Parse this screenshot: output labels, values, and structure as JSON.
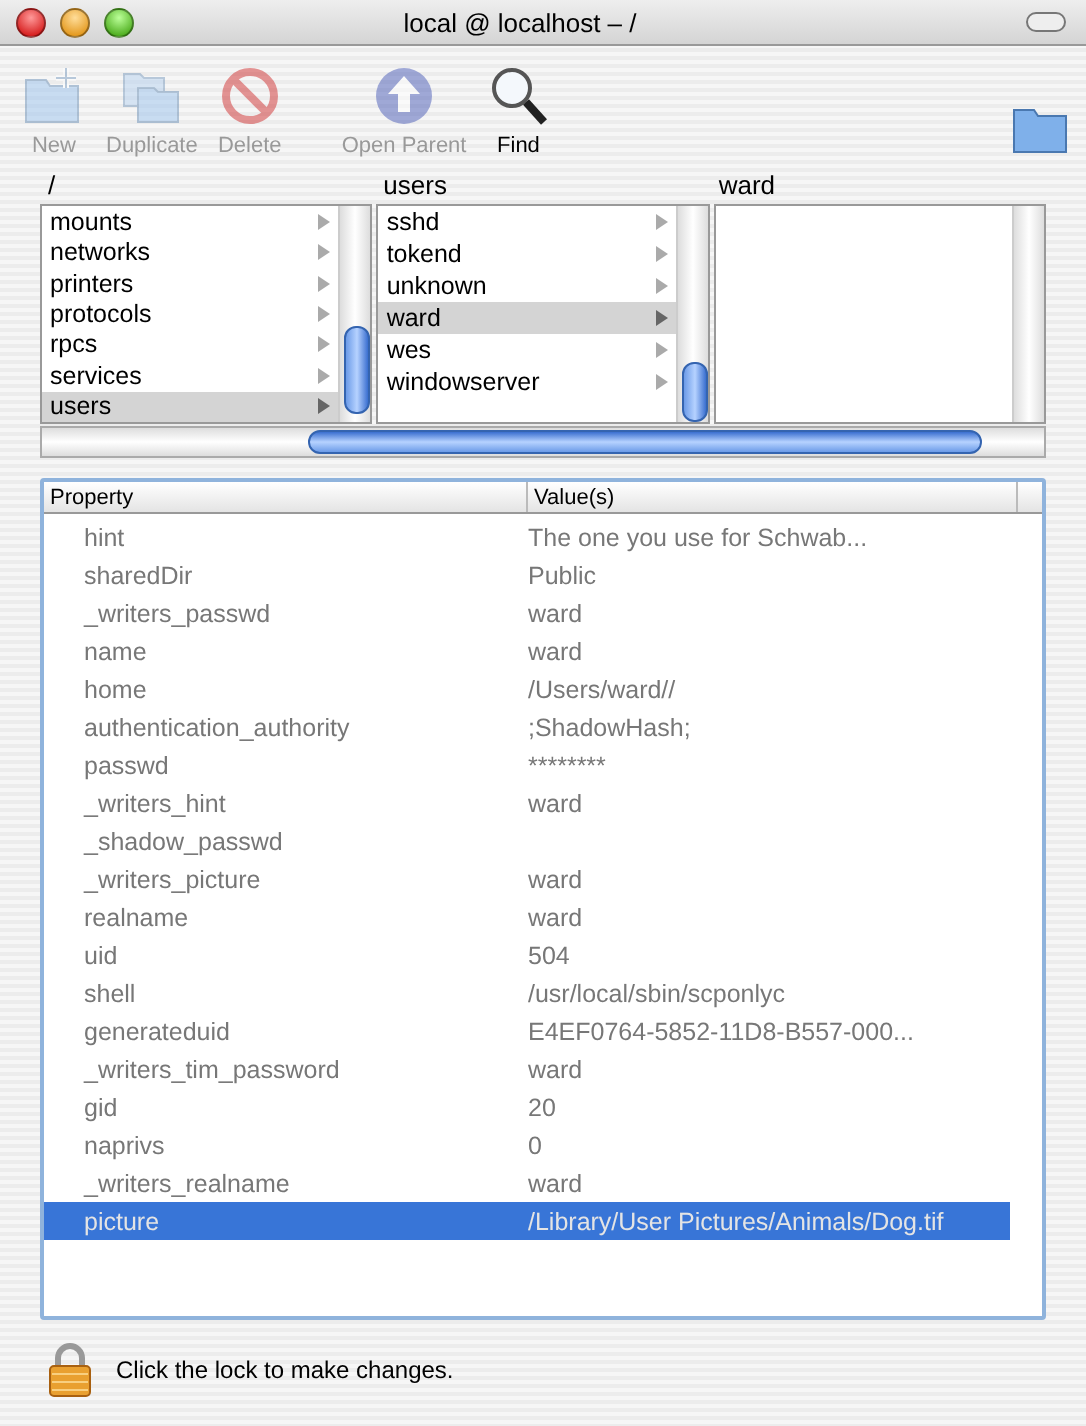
{
  "window": {
    "title": "local @ localhost – /"
  },
  "toolbar": [
    {
      "label": "New",
      "kind": "new",
      "disabled": true
    },
    {
      "label": "Duplicate",
      "kind": "duplicate",
      "disabled": true
    },
    {
      "label": "Delete",
      "kind": "delete",
      "disabled": true
    },
    {
      "label": "Open Parent",
      "kind": "parent",
      "disabled": true
    },
    {
      "label": "Find",
      "kind": "find",
      "disabled": false
    }
  ],
  "browser": {
    "columns": [
      {
        "heading": "/",
        "items": [
          {
            "label": "mounts",
            "selected": false
          },
          {
            "label": "networks",
            "selected": false
          },
          {
            "label": "printers",
            "selected": false
          },
          {
            "label": "protocols",
            "selected": false
          },
          {
            "label": "rpcs",
            "selected": false
          },
          {
            "label": "services",
            "selected": false
          },
          {
            "label": "users",
            "selected": true
          }
        ]
      },
      {
        "heading": "users",
        "items": [
          {
            "label": "sshd",
            "selected": false
          },
          {
            "label": "tokend",
            "selected": false
          },
          {
            "label": "unknown",
            "selected": false
          },
          {
            "label": "ward",
            "selected": true
          },
          {
            "label": "wes",
            "selected": false
          },
          {
            "label": "windowserver",
            "selected": false
          }
        ]
      },
      {
        "heading": "ward"
      }
    ]
  },
  "table": {
    "columns": [
      "Property",
      "Value(s)"
    ],
    "rows": [
      {
        "property": "hint",
        "value": "The one you use for Schwab...",
        "selected": false
      },
      {
        "property": "sharedDir",
        "value": "Public",
        "selected": false
      },
      {
        "property": "_writers_passwd",
        "value": "ward",
        "selected": false
      },
      {
        "property": "name",
        "value": "ward",
        "selected": false
      },
      {
        "property": "home",
        "value": "/Users/ward//",
        "selected": false
      },
      {
        "property": "authentication_authority",
        "value": ";ShadowHash;",
        "selected": false
      },
      {
        "property": "passwd",
        "value": "********",
        "selected": false
      },
      {
        "property": "_writers_hint",
        "value": "ward",
        "selected": false
      },
      {
        "property": "_shadow_passwd",
        "selected": false
      },
      {
        "property": "_writers_picture",
        "value": "ward",
        "selected": false
      },
      {
        "property": "realname",
        "value": "ward",
        "selected": false
      },
      {
        "property": "uid",
        "value": "504",
        "selected": false
      },
      {
        "property": "shell",
        "value": "/usr/local/sbin/scponlyc",
        "selected": false
      },
      {
        "property": "generateduid",
        "value": "E4EF0764-5852-11D8-B557-000...",
        "selected": false
      },
      {
        "property": "_writers_tim_password",
        "value": "ward",
        "selected": false
      },
      {
        "property": "gid",
        "value": "20",
        "selected": false
      },
      {
        "property": "naprivs",
        "value": "0",
        "selected": false
      },
      {
        "property": "_writers_realname",
        "value": "ward",
        "selected": false
      },
      {
        "property": "picture",
        "value": "/Library/User Pictures/Animals/Dog.tif",
        "selected": true
      }
    ]
  },
  "status": {
    "text": "Click the lock to make changes."
  }
}
